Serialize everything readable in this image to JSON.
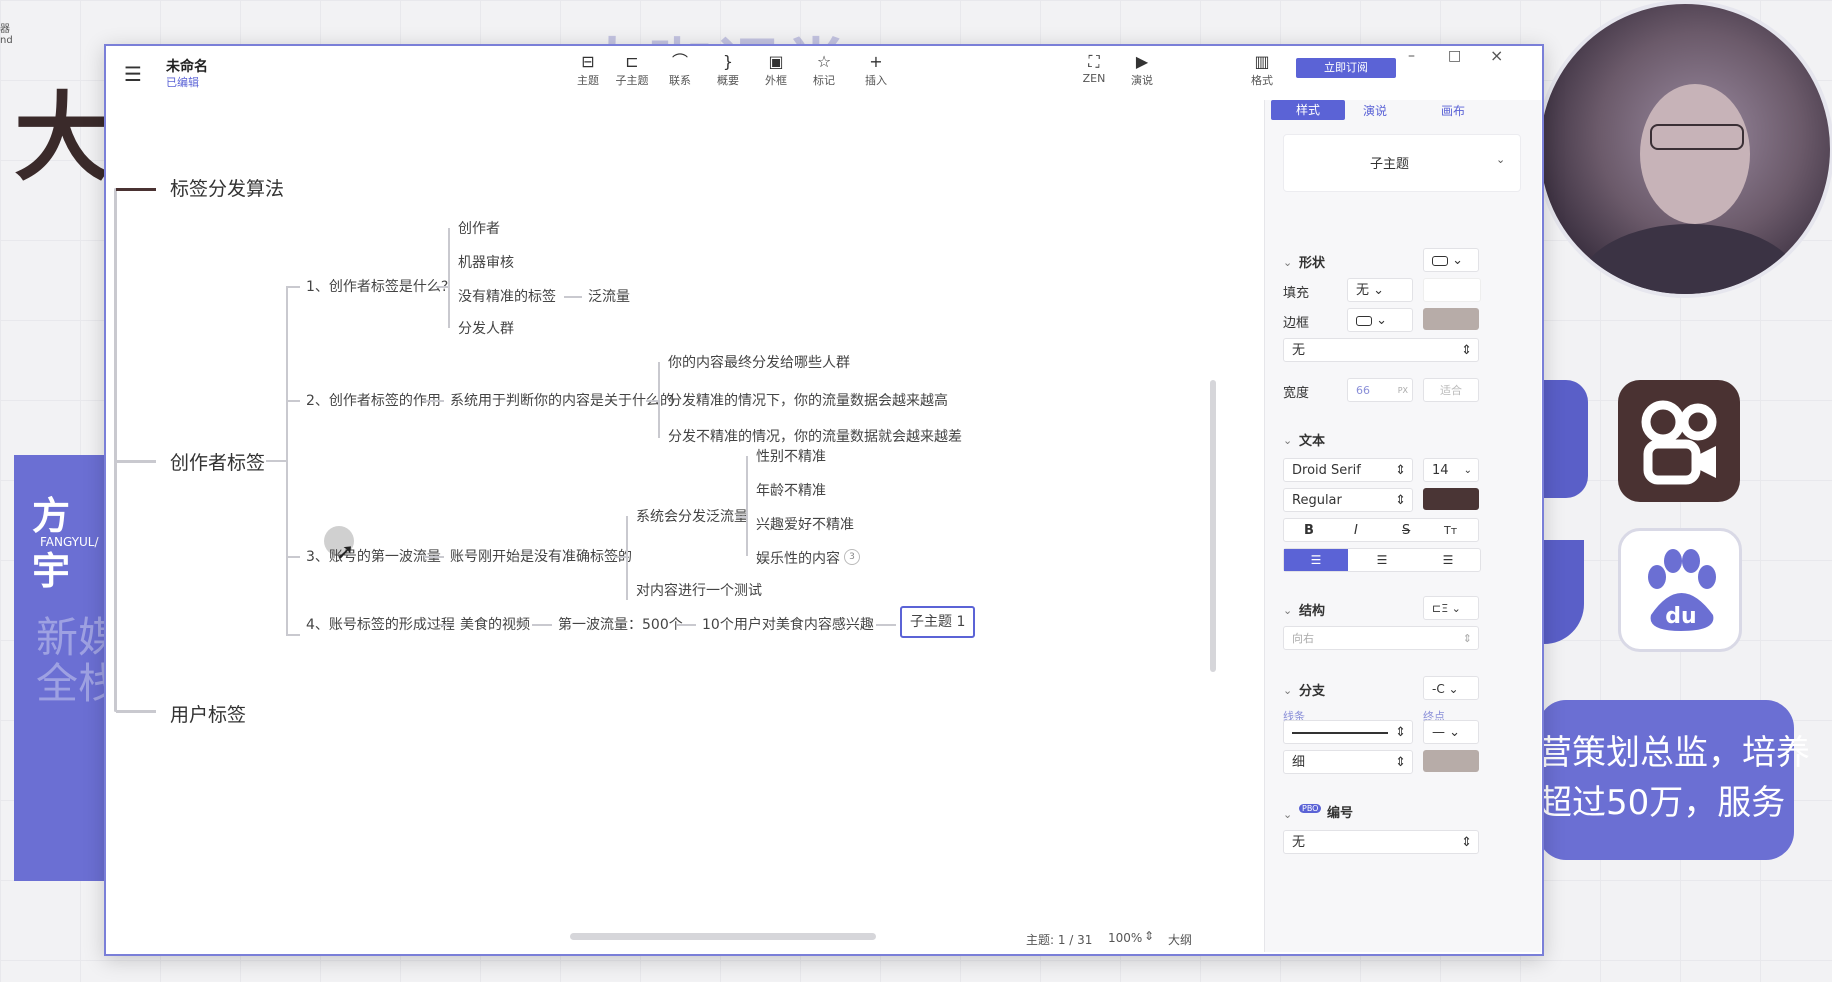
{
  "background": {
    "big_char": "大",
    "card_title": "方宇",
    "card_sub": "FANGYUL/",
    "card_watermark": "新媒\n全栈",
    "bubble_line1": "营策划总监，培养",
    "bubble_line2": "超过50万，服务",
    "top_watermark": "大咖课堂",
    "corner_icons": "器\nnd"
  },
  "window": {
    "doc_title": "未命名",
    "doc_status": "已编辑",
    "toolbar": [
      {
        "label": "主题",
        "icon": "topic-icon",
        "glyph": "⊟"
      },
      {
        "label": "子主题",
        "icon": "subtopic-icon",
        "glyph": "⊏"
      },
      {
        "label": "联系",
        "icon": "relationship-icon",
        "glyph": "⌒"
      },
      {
        "label": "概要",
        "icon": "summary-icon",
        "glyph": "}"
      },
      {
        "label": "外框",
        "icon": "boundary-icon",
        "glyph": "▣"
      },
      {
        "label": "标记",
        "icon": "marker-icon",
        "glyph": "☆"
      },
      {
        "label": "插入",
        "icon": "insert-icon",
        "glyph": "+"
      }
    ],
    "zen_label": "ZEN",
    "present_label": "演说",
    "format_label": "格式",
    "subscribe_label": "立即订阅"
  },
  "mindmap": {
    "main_topics": [
      "标签分发算法",
      "创作者标签",
      "用户标签"
    ],
    "b1": {
      "label": "1、创作者标签是什么?",
      "children": [
        "创作者",
        "机器审核",
        "没有精准的标签",
        "分发人群"
      ],
      "extra": "泛流量"
    },
    "b2": {
      "label": "2、创作者标签的作用",
      "mid": "系统用于判断你的内容是关于什么的",
      "children": [
        "你的内容最终分发给哪些人群",
        "分发精准的情况下，你的流量数据会越来越高",
        "分发不精准的情况，你的流量数据就会越来越差"
      ]
    },
    "b3": {
      "label": "3、账号的第一波流量",
      "mid": "账号刚开始是没有准确标签的",
      "sub1": "系统会分发泛流量",
      "sub1_children": [
        "性别不精准",
        "年龄不精准",
        "兴趣爱好不精准",
        "娱乐性的内容"
      ],
      "badge": "3",
      "sub2": "对内容进行一个测试"
    },
    "b4": {
      "label": "4、账号标签的形成过程",
      "chain": [
        "美食的视频",
        "第一波流量：500个",
        "10个用户对美食内容感兴趣"
      ],
      "selected": "子主题 1"
    }
  },
  "status_bar": {
    "topic_count": "主题: 1 / 31",
    "zoom": "100%",
    "outline": "大纲"
  },
  "panel": {
    "tabs": [
      "样式",
      "演说",
      "画布"
    ],
    "style_select": "子主题",
    "shape_header": "形状",
    "fill_label": "填充",
    "fill_value": "无",
    "border_label": "边框",
    "border_pattern": "无",
    "width_label": "宽度",
    "width_value": "66",
    "width_unit": "PX",
    "fit_label": "适合",
    "text_header": "文本",
    "font_family": "Droid Serif",
    "font_size": "14",
    "font_weight": "Regular",
    "format_buttons": [
      "B",
      "I",
      "S",
      "Tт"
    ],
    "structure_header": "结构",
    "structure_value": "向右",
    "branch_header": "分支",
    "line_label": "线条",
    "end_label": "终点",
    "thickness": "细",
    "number_header": "编号",
    "number_badge": "PBO",
    "number_value": "无",
    "colors": {
      "accent": "#5b63d6",
      "text_color": "#4a3535",
      "border_color": "#b7aca8",
      "branch_color": "#b7aca8"
    }
  }
}
